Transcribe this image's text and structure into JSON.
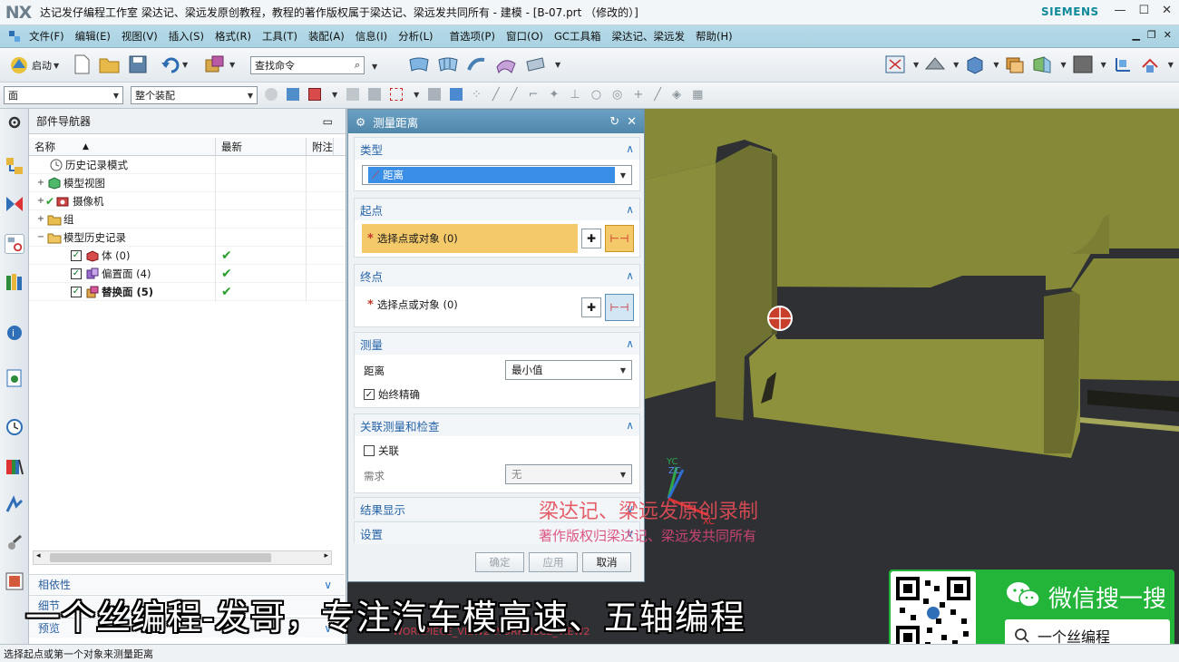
{
  "window": {
    "logo": "NX",
    "title": "达记发仔编程工作室  梁达记、梁远发原创教程，教程的著作版权属于梁达记、梁远发共同所有 - 建模 - [B-07.prt （修改的）]",
    "brand": "SIEMENS"
  },
  "menubar": {
    "items": [
      "文件(F)",
      "编辑(E)",
      "视图(V)",
      "插入(S)",
      "格式(R)",
      "工具(T)",
      "装配(A)",
      "信息(I)",
      "分析(L)",
      "首选项(P)",
      "窗口(O)",
      "GC工具箱",
      "梁达记、梁远发",
      "帮助(H)"
    ]
  },
  "toolbar": {
    "start_label": "启动",
    "command_search_placeholder": "查找命令",
    "selection_filter": "面",
    "assembly_scope": "整个装配"
  },
  "navigator": {
    "title": "部件导航器",
    "columns": [
      "名称",
      "最新",
      "附注"
    ],
    "rows": [
      {
        "label": "历史记录模式",
        "bold": false,
        "check": false
      },
      {
        "label": "模型视图",
        "bold": false,
        "check": false
      },
      {
        "label": "摄像机",
        "bold": false,
        "check": false
      },
      {
        "label": "组",
        "bold": false,
        "check": false
      },
      {
        "label": "模型历史记录",
        "bold": false,
        "check": false
      },
      {
        "label": "体 (0)",
        "bold": false,
        "check": true
      },
      {
        "label": "偏置面 (4)",
        "bold": false,
        "check": true
      },
      {
        "label": "替换面 (5)",
        "bold": true,
        "check": true
      }
    ],
    "sections": [
      "相依性",
      "细节",
      "预览"
    ]
  },
  "dialog": {
    "title": "测量距离",
    "type_section": "类型",
    "type_value": "距离",
    "start_section": "起点",
    "start_select": "选择点或对象 (0)",
    "end_section": "终点",
    "end_select": "选择点或对象 (0)",
    "measure_section": "测量",
    "distance_label": "距离",
    "distance_value": "最小值",
    "always_exact": "始终精确",
    "assoc_section": "关联测量和检查",
    "associative": "关联",
    "requirement_label": "需求",
    "requirement_value": "无",
    "results_section": "结果显示",
    "settings_section": "设置",
    "ok": "确定",
    "apply": "应用",
    "cancel": "取消"
  },
  "viewport": {
    "axis_yc": "YC",
    "axis_zc": "ZC",
    "axis_xc": "XC",
    "view_labels": "WORKPIECE_VIEW2    WORKPIECE_VIEW2"
  },
  "overlay": {
    "watermark_line1": "梁达记、梁远发原创录制",
    "watermark_line2": "著作版权归梁达记、梁远发共同所有",
    "subtitle": "一个丝编程-发哥，专注汽车模高速、五轴编程",
    "wechat_title": "微信搜一搜",
    "wechat_query": "一个丝编程"
  },
  "status": "选择起点或第一个对象来测量距离",
  "colors": {
    "model_face": "#8a8a3a",
    "viewport_bg": "#2f3034",
    "dialog_header": "#5a90b3",
    "selection_highlight": "#f4c96a",
    "wechat_green": "#23b53a"
  }
}
